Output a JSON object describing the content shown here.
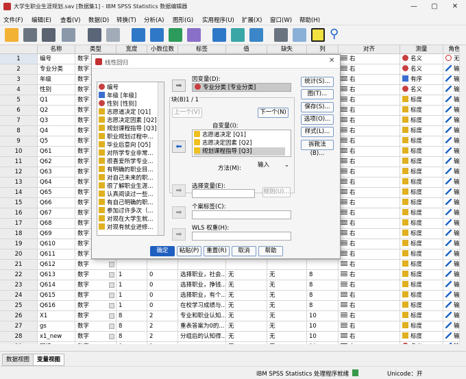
{
  "window": {
    "title": "大学生职业生涯规划.sav [数据集1] - IBM SPSS Statistics 数据编辑器",
    "minimize": "—",
    "maximize": "▢",
    "close": "✕"
  },
  "menu": [
    "文件(F)",
    "编辑(E)",
    "查看(V)",
    "数据(D)",
    "转换(T)",
    "分析(A)",
    "图形(G)",
    "实用程序(U)",
    "扩展(X)",
    "窗口(W)",
    "帮助(H)"
  ],
  "columns": [
    "名称",
    "类型",
    "宽度",
    "小数位数",
    "标签",
    "值",
    "缺失",
    "列",
    "对齐",
    "测量",
    "角色"
  ],
  "rows": [
    {
      "n": "1",
      "name": "编号",
      "type": "数字",
      "width": "",
      "dec": "",
      "label": "",
      "values": "",
      "missing": "",
      "cols": "",
      "align": "右",
      "measure": "名义",
      "role": "无",
      "micon": "nominal",
      "ricon": "none"
    },
    {
      "n": "2",
      "name": "专业分类",
      "type": "数字",
      "width": "",
      "dec": "",
      "label": "",
      "values": "",
      "missing": "",
      "cols": "",
      "align": "右",
      "measure": "名义",
      "role": "输入",
      "micon": "nominal",
      "ricon": "input"
    },
    {
      "n": "3",
      "name": "年级",
      "type": "数字",
      "width": "",
      "dec": "",
      "label": "",
      "values": "",
      "missing": "",
      "cols": "",
      "align": "右",
      "measure": "有序",
      "role": "输入",
      "micon": "ordinal",
      "ricon": "input"
    },
    {
      "n": "4",
      "name": "性别",
      "type": "数字",
      "width": "",
      "dec": "",
      "label": "",
      "values": "",
      "missing": "",
      "cols": "",
      "align": "右",
      "measure": "名义",
      "role": "输入",
      "micon": "nominal",
      "ricon": "input"
    },
    {
      "n": "5",
      "name": "Q1",
      "type": "数字",
      "width": "",
      "dec": "",
      "label": "",
      "values": "",
      "missing": "",
      "cols": "",
      "align": "右",
      "measure": "标度",
      "role": "输入",
      "micon": "scale",
      "ricon": "input"
    },
    {
      "n": "6",
      "name": "Q2",
      "type": "数字",
      "width": "",
      "dec": "",
      "label": "",
      "values": "",
      "missing": "",
      "cols": "",
      "align": "右",
      "measure": "标度",
      "role": "输入",
      "micon": "scale",
      "ricon": "input"
    },
    {
      "n": "7",
      "name": "Q3",
      "type": "数字",
      "width": "",
      "dec": "",
      "label": "",
      "values": "",
      "missing": "",
      "cols": "",
      "align": "右",
      "measure": "标度",
      "role": "输入",
      "micon": "scale",
      "ricon": "input"
    },
    {
      "n": "8",
      "name": "Q4",
      "type": "数字",
      "width": "",
      "dec": "",
      "label": "",
      "values": "",
      "missing": "",
      "cols": "",
      "align": "右",
      "measure": "标度",
      "role": "输入",
      "micon": "scale",
      "ricon": "input"
    },
    {
      "n": "9",
      "name": "Q5",
      "type": "数字",
      "width": "",
      "dec": "",
      "label": "",
      "values": "",
      "missing": "",
      "cols": "",
      "align": "右",
      "measure": "标度",
      "role": "输入",
      "micon": "scale",
      "ricon": "input"
    },
    {
      "n": "10",
      "name": "Q61",
      "type": "数字",
      "width": "",
      "dec": "",
      "label": "",
      "values": "",
      "missing": "",
      "cols": "",
      "align": "右",
      "measure": "标度",
      "role": "输入",
      "micon": "scale",
      "ricon": "input"
    },
    {
      "n": "11",
      "name": "Q62",
      "type": "数字",
      "width": "",
      "dec": "",
      "label": "",
      "values": "",
      "missing": "",
      "cols": "",
      "align": "右",
      "measure": "标度",
      "role": "输入",
      "micon": "scale",
      "ricon": "input"
    },
    {
      "n": "12",
      "name": "Q63",
      "type": "数字",
      "width": "",
      "dec": "",
      "label": "",
      "values": "",
      "missing": "",
      "cols": "",
      "align": "右",
      "measure": "标度",
      "role": "输入",
      "micon": "scale",
      "ricon": "input"
    },
    {
      "n": "13",
      "name": "Q64",
      "type": "数字",
      "width": "",
      "dec": "",
      "label": "",
      "values": "",
      "missing": "",
      "cols": "",
      "align": "右",
      "measure": "标度",
      "role": "输入",
      "micon": "scale",
      "ricon": "input"
    },
    {
      "n": "14",
      "name": "Q65",
      "type": "数字",
      "width": "",
      "dec": "",
      "label": "",
      "values": "",
      "missing": "",
      "cols": "",
      "align": "右",
      "measure": "标度",
      "role": "输入",
      "micon": "scale",
      "ricon": "input"
    },
    {
      "n": "15",
      "name": "Q66",
      "type": "数字",
      "width": "",
      "dec": "",
      "label": "",
      "values": "",
      "missing": "",
      "cols": "",
      "align": "右",
      "measure": "标度",
      "role": "输入",
      "micon": "scale",
      "ricon": "input"
    },
    {
      "n": "16",
      "name": "Q67",
      "type": "数字",
      "width": "",
      "dec": "",
      "label": "",
      "values": "",
      "missing": "",
      "cols": "",
      "align": "右",
      "measure": "标度",
      "role": "输入",
      "micon": "scale",
      "ricon": "input"
    },
    {
      "n": "17",
      "name": "Q68",
      "type": "数字",
      "width": "",
      "dec": "",
      "label": "",
      "values": "",
      "missing": "",
      "cols": "",
      "align": "右",
      "measure": "标度",
      "role": "输入",
      "micon": "scale",
      "ricon": "input"
    },
    {
      "n": "18",
      "name": "Q69",
      "type": "数字",
      "width": "",
      "dec": "",
      "label": "",
      "values": "",
      "missing": "",
      "cols": "",
      "align": "右",
      "measure": "标度",
      "role": "输入",
      "micon": "scale",
      "ricon": "input"
    },
    {
      "n": "19",
      "name": "Q610",
      "type": "数字",
      "width": "",
      "dec": "",
      "label": "",
      "values": "",
      "missing": "",
      "cols": "",
      "align": "右",
      "measure": "标度",
      "role": "输入",
      "micon": "scale",
      "ricon": "input"
    },
    {
      "n": "20",
      "name": "Q611",
      "type": "数字",
      "width": "",
      "dec": "",
      "label": "",
      "values": "",
      "missing": "",
      "cols": "",
      "align": "右",
      "measure": "标度",
      "role": "输入",
      "micon": "scale",
      "ricon": "input"
    },
    {
      "n": "21",
      "name": "Q612",
      "type": "数字",
      "width": "",
      "dec": "",
      "label": "",
      "values": "",
      "missing": "",
      "cols": "",
      "align": "右",
      "measure": "标度",
      "role": "输入",
      "micon": "scale",
      "ricon": "input"
    },
    {
      "n": "22",
      "name": "Q613",
      "type": "数字",
      "width": "1",
      "dec": "0",
      "label": "选择职业，社会...",
      "values": "无",
      "missing": "无",
      "cols": "8",
      "align": "右",
      "measure": "标度",
      "role": "输入",
      "micon": "scale",
      "ricon": "input"
    },
    {
      "n": "23",
      "name": "Q614",
      "type": "数字",
      "width": "1",
      "dec": "0",
      "label": "选择职业，挣钱...",
      "values": "无",
      "missing": "无",
      "cols": "8",
      "align": "右",
      "measure": "标度",
      "role": "输入",
      "micon": "scale",
      "ricon": "input"
    },
    {
      "n": "24",
      "name": "Q615",
      "type": "数字",
      "width": "1",
      "dec": "0",
      "label": "选择职业，有个...",
      "values": "无",
      "missing": "无",
      "cols": "8",
      "align": "右",
      "measure": "标度",
      "role": "输入",
      "micon": "scale",
      "ricon": "input"
    },
    {
      "n": "25",
      "name": "Q616",
      "type": "数字",
      "width": "1",
      "dec": "0",
      "label": "在校学习成绩与...",
      "values": "无",
      "missing": "无",
      "cols": "8",
      "align": "右",
      "measure": "标度",
      "role": "输入",
      "micon": "scale",
      "ricon": "input"
    },
    {
      "n": "26",
      "name": "X1",
      "type": "数字",
      "width": "8",
      "dec": "2",
      "label": "专业和职业认知...",
      "values": "无",
      "missing": "无",
      "cols": "10",
      "align": "右",
      "measure": "标度",
      "role": "输入",
      "micon": "scale",
      "ricon": "input"
    },
    {
      "n": "27",
      "name": "gs",
      "type": "数字",
      "width": "8",
      "dec": "2",
      "label": "重表答案为0的...",
      "values": "无",
      "missing": "无",
      "cols": "10",
      "align": "右",
      "measure": "标度",
      "role": "输入",
      "micon": "scale",
      "ricon": "input"
    },
    {
      "n": "28",
      "name": "x1_new",
      "type": "数字",
      "width": "8",
      "dec": "2",
      "label": "分组后的认知得...",
      "values": "无",
      "missing": "无",
      "cols": "10",
      "align": "右",
      "measure": "标度",
      "role": "输入",
      "micon": "scale",
      "ricon": "input"
    },
    {
      "n": "29",
      "name": "环境",
      "type": "数字",
      "width": "8",
      "dec": "2",
      "label": "",
      "values": "无",
      "missing": "无",
      "cols": "10",
      "align": "右",
      "measure": "名义",
      "role": "输入",
      "micon": "nominal",
      "ricon": "input"
    }
  ],
  "tabs": {
    "data_view": "数据视图",
    "variable_view": "变量视图"
  },
  "status": {
    "processor": "IBM SPSS Statistics 处理程序就绪",
    "unicode": "Unicode：开"
  },
  "dialog": {
    "title": "线性回归",
    "variables": [
      {
        "label": "编号",
        "icon": "nominal"
      },
      {
        "label": "年级 [年级]",
        "icon": "ordinal"
      },
      {
        "label": "性别 [性别]",
        "icon": "nominal"
      },
      {
        "label": "志愿道决定 [Q1]",
        "icon": "scale"
      },
      {
        "label": "志愿决定因素 [Q2]",
        "icon": "scale"
      },
      {
        "label": "规划课程指导 [Q3]",
        "icon": "scale"
      },
      {
        "label": "职业规划过程中...",
        "icon": "scale"
      },
      {
        "label": "毕业后意向 [Q5]",
        "icon": "scale"
      },
      {
        "label": "对所学专业非常...",
        "icon": "scale"
      },
      {
        "label": "很喜爱所学专业...",
        "icon": "scale"
      },
      {
        "label": "有明确的职业目...",
        "icon": "scale"
      },
      {
        "label": "对自己未来的职...",
        "icon": "scale"
      },
      {
        "label": "很了解职业生涯...",
        "icon": "scale"
      },
      {
        "label": "认真阅读过一些...",
        "icon": "scale"
      },
      {
        "label": "有自己明确的职...",
        "icon": "scale"
      },
      {
        "label": "参加过许多次（...",
        "icon": "scale"
      },
      {
        "label": "对现在大学生就...",
        "icon": "scale"
      },
      {
        "label": "对现有就业进修...",
        "icon": "scale"
      }
    ],
    "dependent_label": "因变量(D):",
    "dependent_value": "专业分类 [专业分类]",
    "block_label": "块(B)1 / 1",
    "prev_btn": "上一个(V)",
    "next_btn": "下一个(N)",
    "independent_label": "自变量(I):",
    "independents": [
      "志愿道决定 [Q1]",
      "志愿决定因素 [Q2]",
      "规划课程指导 [Q3]"
    ],
    "method_label": "方法(M):",
    "method_value": "输入",
    "selection_label": "选择变量(E):",
    "rule_btn": "规则(U)...",
    "case_label": "个案标签(C):",
    "wls_label": "WLS 权重(H):",
    "side_buttons": [
      "统计(S)...",
      "图(T)...",
      "保存(S)...",
      "选项(O)...",
      "样式(L)...",
      "拆靴法(B)..."
    ],
    "bottom_buttons": [
      "确定",
      "粘贴(P)",
      "重置(R)",
      "取消",
      "帮助"
    ]
  }
}
